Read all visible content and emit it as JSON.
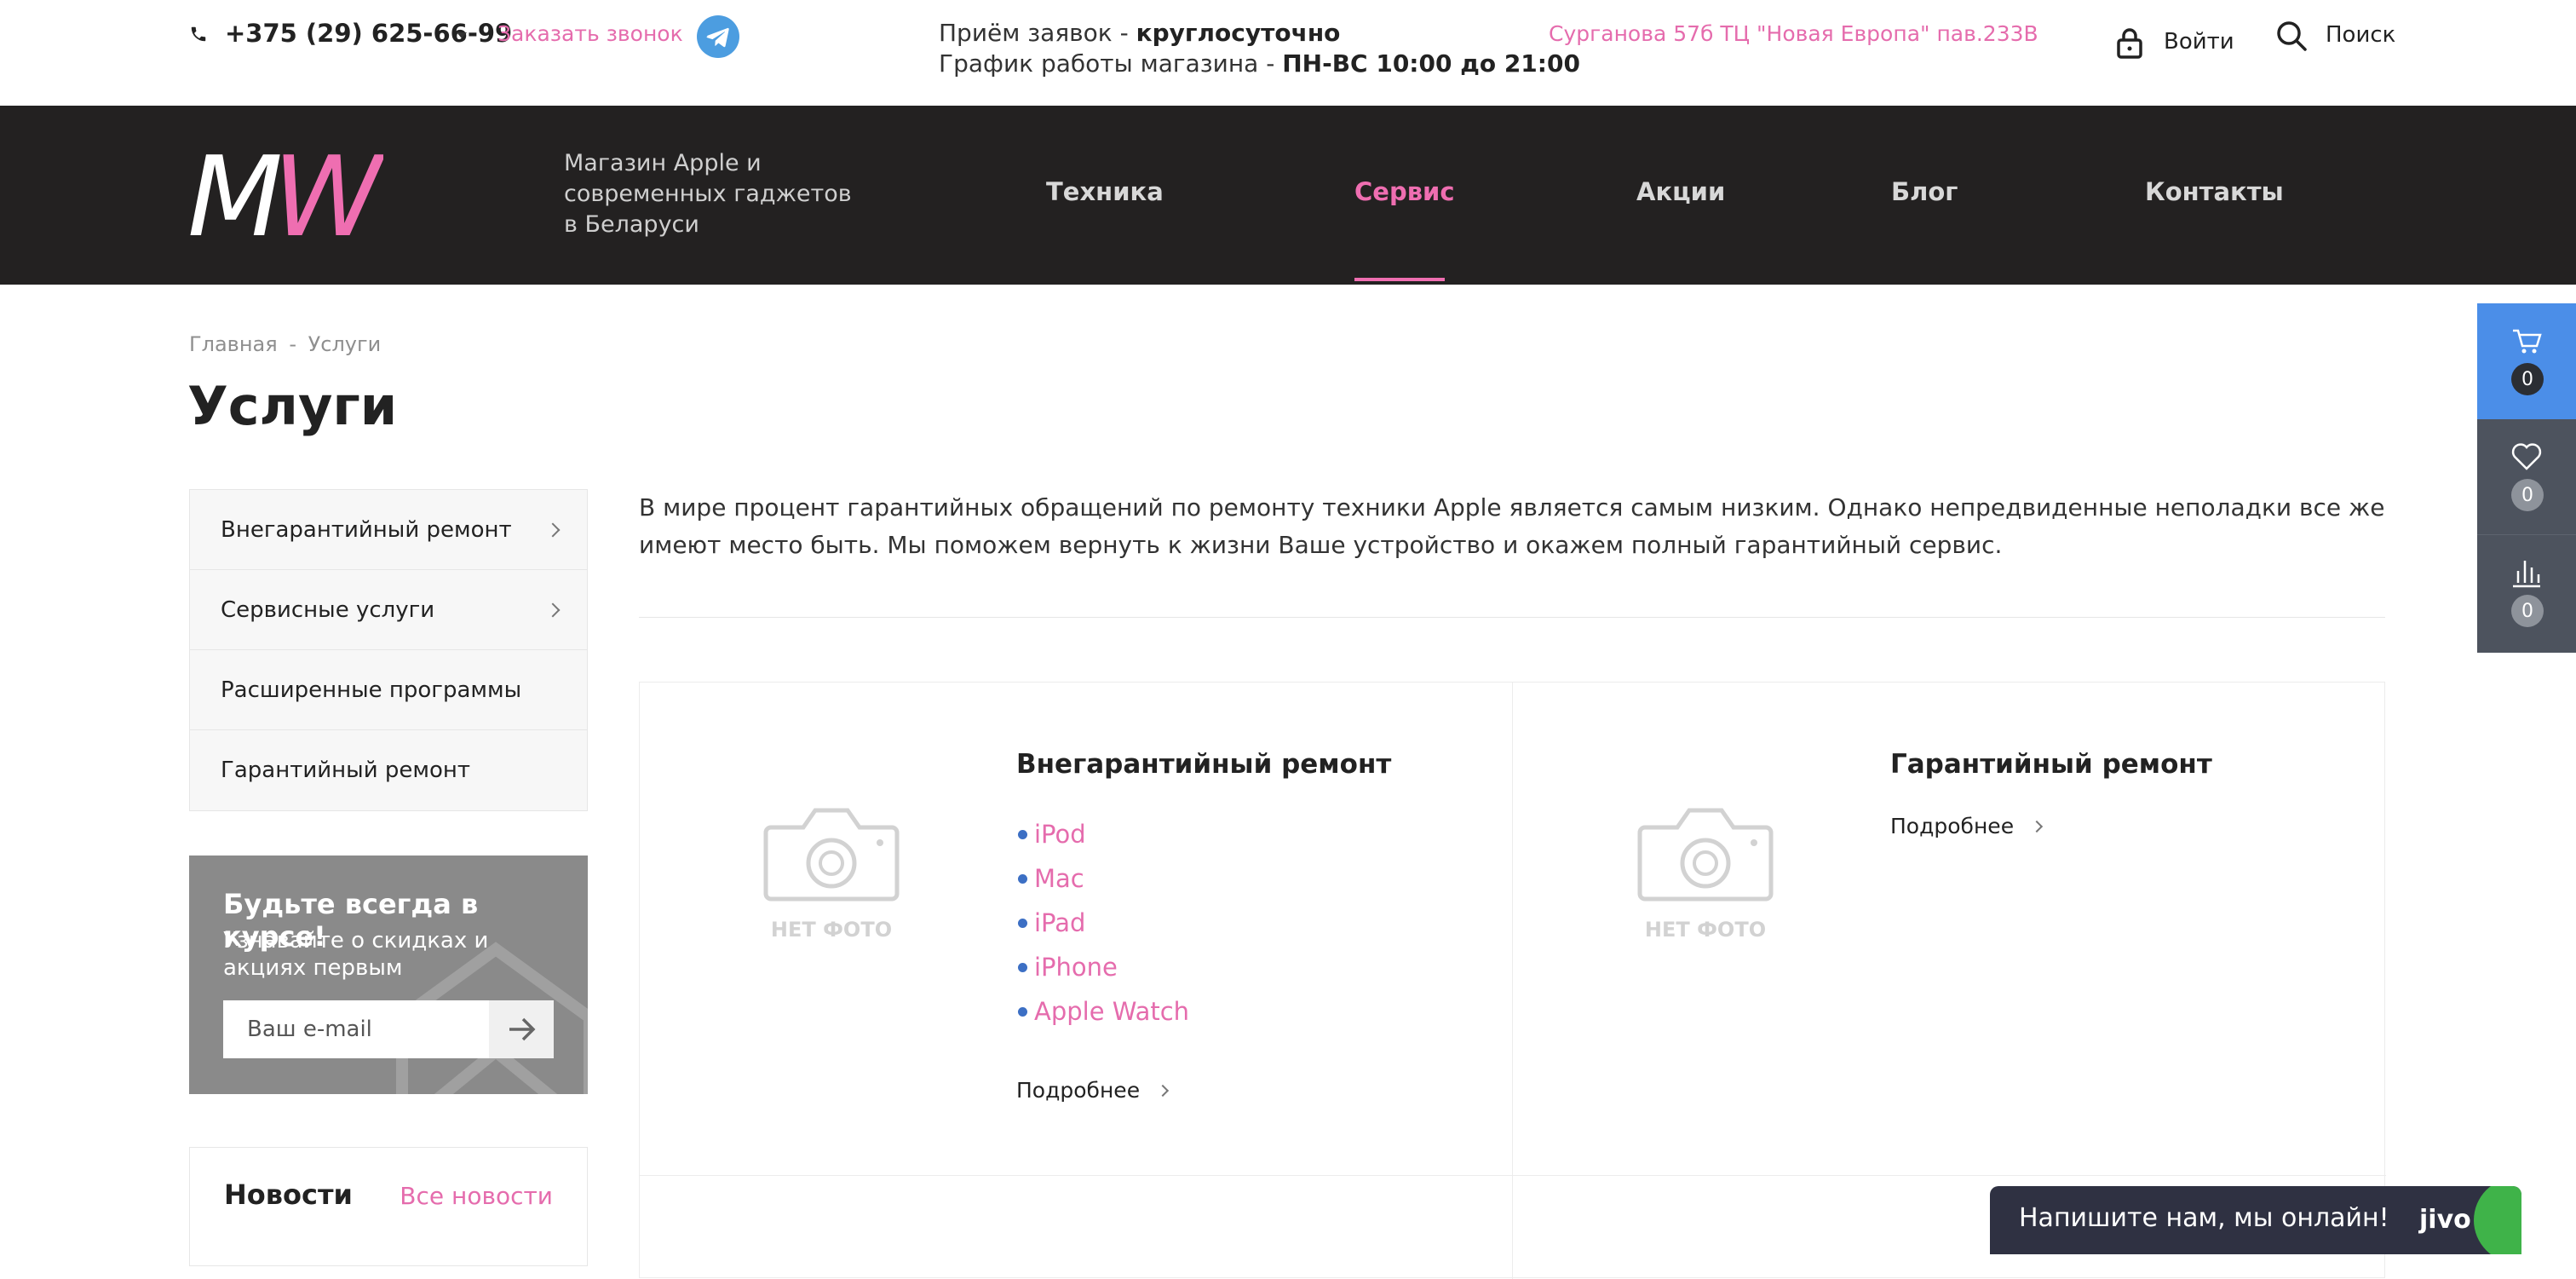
{
  "topbar": {
    "phone": "+375 (29) 625-66-99",
    "callback": "Заказать звонок",
    "hours_line1_prefix": "Приём заявок - ",
    "hours_line1_bold": "круглосуточно",
    "hours_line2_prefix": "График работы магазина - ",
    "hours_line2_bold": "ПН-ВС 10:00 до 21:00",
    "address": "Сурганова 57б ТЦ \"Новая Европа\" пав.233В",
    "login": "Войти",
    "search": "Поиск"
  },
  "header": {
    "logo_text_1": "M",
    "logo_text_2": "W",
    "tagline": "Магазин Apple и современных гаджетов в Беларуси",
    "nav": [
      {
        "label": "Техника"
      },
      {
        "label": "Сервис"
      },
      {
        "label": "Акции"
      },
      {
        "label": "Блог"
      },
      {
        "label": "Контакты"
      }
    ],
    "active_nav": "Сервис"
  },
  "breadcrumb": {
    "home": "Главная",
    "separator": "-",
    "current": "Услуги"
  },
  "page_title": "Услуги",
  "sidebar": {
    "items": [
      {
        "label": "Внегарантийный ремонт"
      },
      {
        "label": "Сервисные услуги"
      },
      {
        "label": "Расширенные программы"
      },
      {
        "label": "Гарантийный ремонт"
      }
    ],
    "subscribe": {
      "title": "Будьте всегда в курсе!",
      "text": "Узнавайте о скидках и акциях первым",
      "placeholder": "Ваш e-mail"
    },
    "news": {
      "title": "Новости",
      "all": "Все новости"
    }
  },
  "main": {
    "intro": "В мире процент гарантийных обращений по ремонту техники Apple является самым низким. Однако непредвиденные неполадки все же имеют место быть. Мы поможем вернуть к жизни Ваше устройство и окажем полный гарантийный сервис.",
    "no_photo": "НЕТ ФОТО",
    "cards": [
      {
        "title": "Внегарантийный ремонт",
        "links": [
          "iPod",
          "Mac",
          "iPad",
          "iPhone",
          "Apple Watch"
        ],
        "more": "Подробнее"
      },
      {
        "title": "Гарантийный ремонт",
        "more": "Подробнее"
      }
    ]
  },
  "side_widget": {
    "cart_count": "0",
    "favorites_count": "0",
    "compare_count": "0"
  },
  "chat": {
    "text": "Напишите нам, мы онлайн!",
    "brand": "jivo"
  },
  "colors": {
    "accent_pink": "#e56cad",
    "header_dark": "#232121",
    "widget_blue": "#4b8ee8",
    "bullet_blue": "#3c6fc4"
  }
}
